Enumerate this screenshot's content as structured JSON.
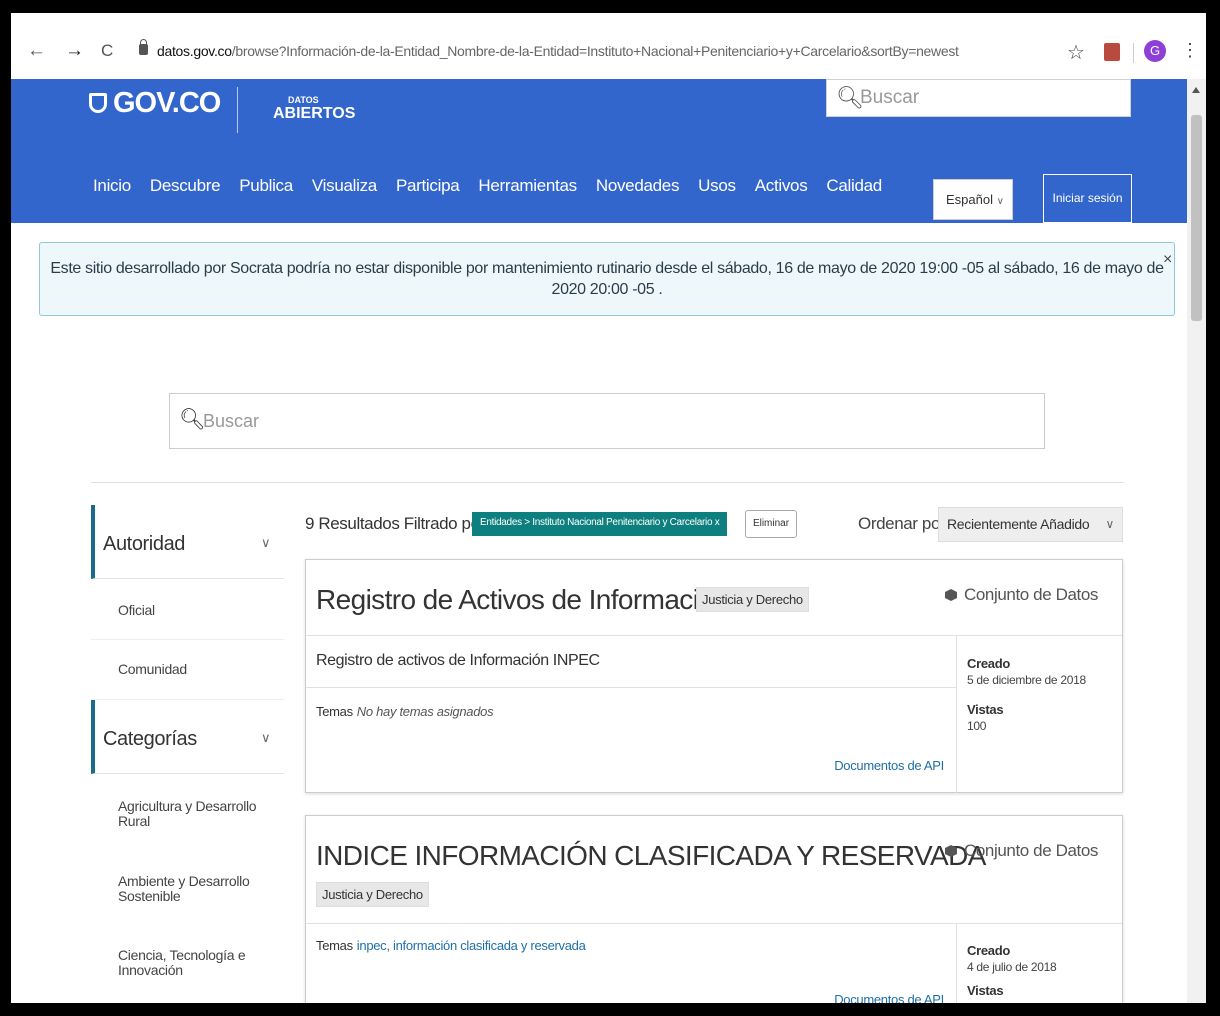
{
  "browser": {
    "back": "←",
    "forward": "→",
    "reload": "C",
    "url_host": "datos.gov.co",
    "url_rest": "/browse?Información-de-la-Entidad_Nombre-de-la-Entidad=Instituto+Nacional+Penitenciario+y+Carcelario&sortBy=newest",
    "star": "☆",
    "avatar": "G",
    "menu": "⋮"
  },
  "header": {
    "gov_logo": "GOV.CO",
    "datos_small": "DATOS",
    "datos_big": "ABIERTOS",
    "search_placeholder": "Buscar",
    "nav": [
      "Inicio",
      "Descubre",
      "Publica",
      "Visualiza",
      "Participa",
      "Herramientas",
      "Novedades",
      "Usos",
      "Activos",
      "Calidad"
    ],
    "language": "Español",
    "login": "Iniciar sesión"
  },
  "notice": {
    "text": "Este sitio desarrollado por Socrata podría no estar disponible por mantenimiento rutinario desde el  sábado, 16 de mayo de 2020 19:00 -05  al  sábado, 16 de mayo de 2020 20:00 -05 .",
    "close": "×"
  },
  "search": {
    "placeholder": "Buscar"
  },
  "sidebar": {
    "autoridad": {
      "title": "Autoridad",
      "items": [
        "Oficial",
        "Comunidad"
      ]
    },
    "categorias": {
      "title": "Categorías",
      "items": [
        "Agricultura y Desarrollo Rural",
        "Ambiente y Desarrollo Sostenible",
        "Ciencia, Tecnología e Innovación"
      ]
    }
  },
  "results": {
    "count_text": "9 Resultados Filtrado por",
    "filter_chip": "Entidades > Instituto Nacional Penitenciario y Carcelario",
    "filter_chip_x": "x",
    "clear": "Eliminar",
    "sort_label": "Ordenar por",
    "sort_value": "Recientemente Añadido"
  },
  "cards": [
    {
      "title": "Registro de Activos de Información",
      "tag": "Justicia y Derecho",
      "type": "Conjunto de Datos",
      "description": "Registro de activos de Información INPEC",
      "temas_label": "Temas",
      "temas_value": "No hay temas asignados",
      "api": "Documentos de API",
      "created_label": "Creado",
      "created_value": "5 de diciembre de 2018",
      "views_label": "Vistas",
      "views_value": "100"
    },
    {
      "title": "INDICE INFORMACIÓN CLASIFICADA Y RESERVADA",
      "tag": "Justicia y Derecho",
      "type": "Conjunto de Datos",
      "temas_label": "Temas",
      "temas_value": "inpec, información clasificada y reservada",
      "api": "Documentos de API",
      "created_label": "Creado",
      "created_value": "4 de julio de 2018",
      "views_label": "Vistas"
    }
  ],
  "colors": {
    "header_blue": "#3366cc",
    "chip_teal": "#0e7f7f",
    "link_blue": "#1f6fa8",
    "notice_bg": "#eef8fb"
  }
}
